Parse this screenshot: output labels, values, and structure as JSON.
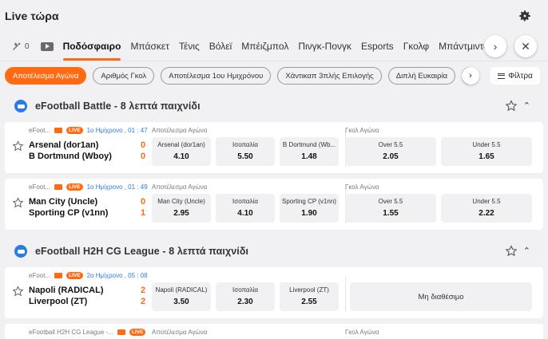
{
  "header": {
    "title": "Live τώρα"
  },
  "sports_tabs": {
    "favorites_count": "0",
    "items": [
      "Ποδόσφαιρο",
      "Μπάσκετ",
      "Τένις",
      "Βόλεϊ",
      "Μπέιζμπολ",
      "Πινγκ-Πονγκ",
      "Esports",
      "Γκολφ",
      "Μπάντμιντον"
    ],
    "active_index": 0
  },
  "filters": {
    "items": [
      "Αποτέλεσμα Αγώνα",
      "Αριθμός Γκολ",
      "Αποτέλεσμα 1ου Ημιχρόνου",
      "Χάντικαπ 3πλής Επιλογής",
      "Διπλή Ευκαιρία"
    ],
    "active_index": 0,
    "filter_label": "Φίλτρα"
  },
  "leagues": [
    {
      "name": "eFootball Battle - 8 λεπτά παιχνίδι",
      "matches": [
        {
          "meta": "eFoot...",
          "live": "LIVE",
          "period": "1ο Ημίχρονο , 01 : 47",
          "home": "Arsenal (dor1an)",
          "away": "B Dortmund (Wboy)",
          "home_score": "0",
          "away_score": "0",
          "market1": "Αποτέλεσμα Αγώνα",
          "odds1": [
            {
              "label": "Arsenal (dor1an)",
              "value": "4.10"
            },
            {
              "label": "Ισοπαλία",
              "value": "5.50"
            },
            {
              "label": "B Dortmund (Wb...",
              "value": "1.48"
            }
          ],
          "market2": "Γκολ Αγώνα",
          "odds2": [
            {
              "label": "Over 5.5",
              "value": "2.05"
            },
            {
              "label": "Under 5.5",
              "value": "1.65"
            }
          ]
        },
        {
          "meta": "eFoot...",
          "live": "LIVE",
          "period": "1ο Ημίχρονο , 01 : 49",
          "home": "Man City (Uncle)",
          "away": "Sporting CP (v1nn)",
          "home_score": "0",
          "away_score": "1",
          "market1": "Αποτέλεσμα Αγώνα",
          "odds1": [
            {
              "label": "Man City (Uncle)",
              "value": "2.95"
            },
            {
              "label": "Ισοπαλία",
              "value": "4.10"
            },
            {
              "label": "Sporting CP (v1nn)",
              "value": "1.90"
            }
          ],
          "market2": "Γκολ Αγώνα",
          "odds2": [
            {
              "label": "Over 5.5",
              "value": "1.55"
            },
            {
              "label": "Under 5.5",
              "value": "2.22"
            }
          ]
        }
      ]
    },
    {
      "name": "eFootball H2H CG League - 8 λεπτά παιχνίδι",
      "matches": [
        {
          "meta": "eFoot...",
          "live": "LIVE",
          "period": "2ο Ημίχρονο , 05 : 08",
          "home": "Napoli (RADICAL)",
          "away": "Liverpool (ZT)",
          "home_score": "2",
          "away_score": "2",
          "market1": "Αποτέλεσμα Αγώνα",
          "odds1": [
            {
              "label": "Napoli (RADICAL)",
              "value": "3.50"
            },
            {
              "label": "Ισοπαλία",
              "value": "2.30"
            },
            {
              "label": "Liverpool (ZT)",
              "value": "2.55"
            }
          ],
          "unavailable": "Μη διαθέσιμο"
        }
      ],
      "partial_match": {
        "meta": "eFootball H2H CG League -...",
        "live": "LIVE",
        "market1": "Αποτέλεσμα Αγώνα",
        "market2": "Γκολ Αγώνα"
      }
    }
  ],
  "colors": {
    "accent": "#ff6a13",
    "period_blue": "#2c7be5",
    "league_icon": "#2c7be5"
  }
}
